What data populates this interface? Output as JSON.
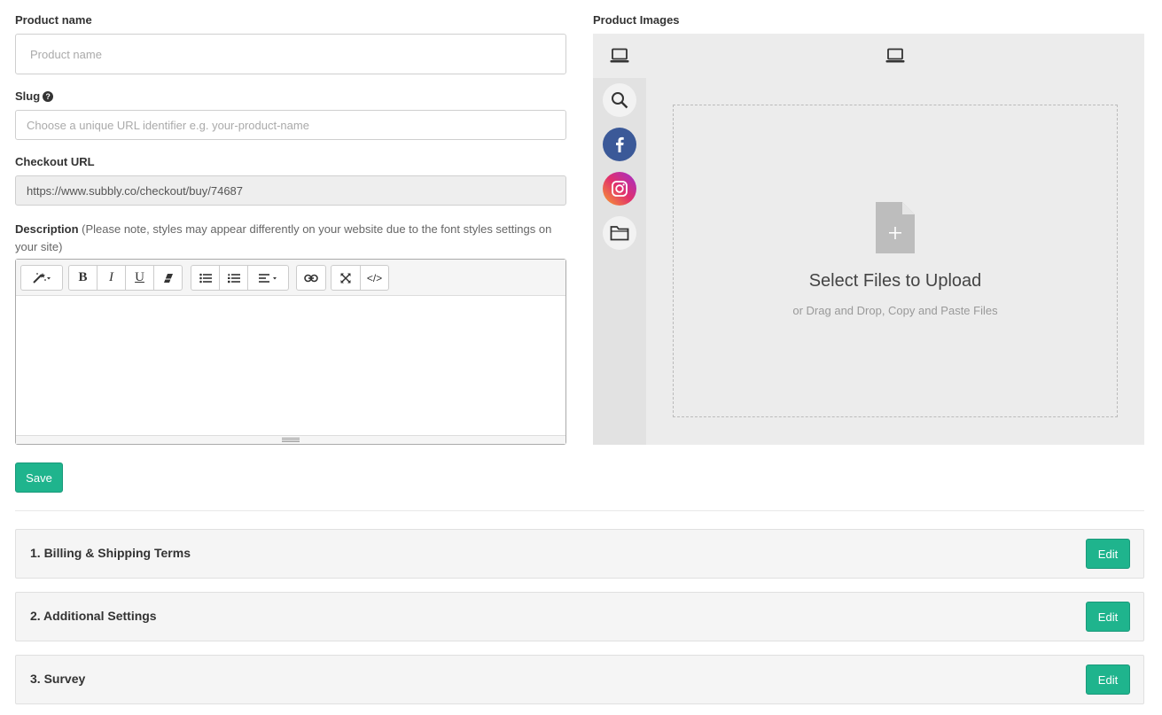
{
  "form": {
    "product_name_label": "Product name",
    "product_name_placeholder": "Product name",
    "slug_label": "Slug",
    "slug_placeholder": "Choose a unique URL identifier e.g. your-product-name",
    "checkout_url_label": "Checkout URL",
    "checkout_url_value": "https://www.subbly.co/checkout/buy/74687",
    "description_label": "Description",
    "description_note": "(Please note, styles may appear differently on your website due to the font styles settings on your site)",
    "save_label": "Save"
  },
  "editor_toolbar": {
    "bold": "B",
    "italic": "I",
    "underline": "U",
    "codeview": "</>"
  },
  "images": {
    "label": "Product Images",
    "drop_title": "Select Files to Upload",
    "drop_subtitle": "or Drag and Drop, Copy and Paste Files"
  },
  "sections": [
    {
      "title": "1. Billing & Shipping Terms",
      "button": "Edit"
    },
    {
      "title": "2. Additional Settings",
      "button": "Edit"
    },
    {
      "title": "3. Survey",
      "button": "Edit"
    }
  ],
  "colors": {
    "accent": "#1fb48d",
    "facebook": "#3b5998"
  }
}
